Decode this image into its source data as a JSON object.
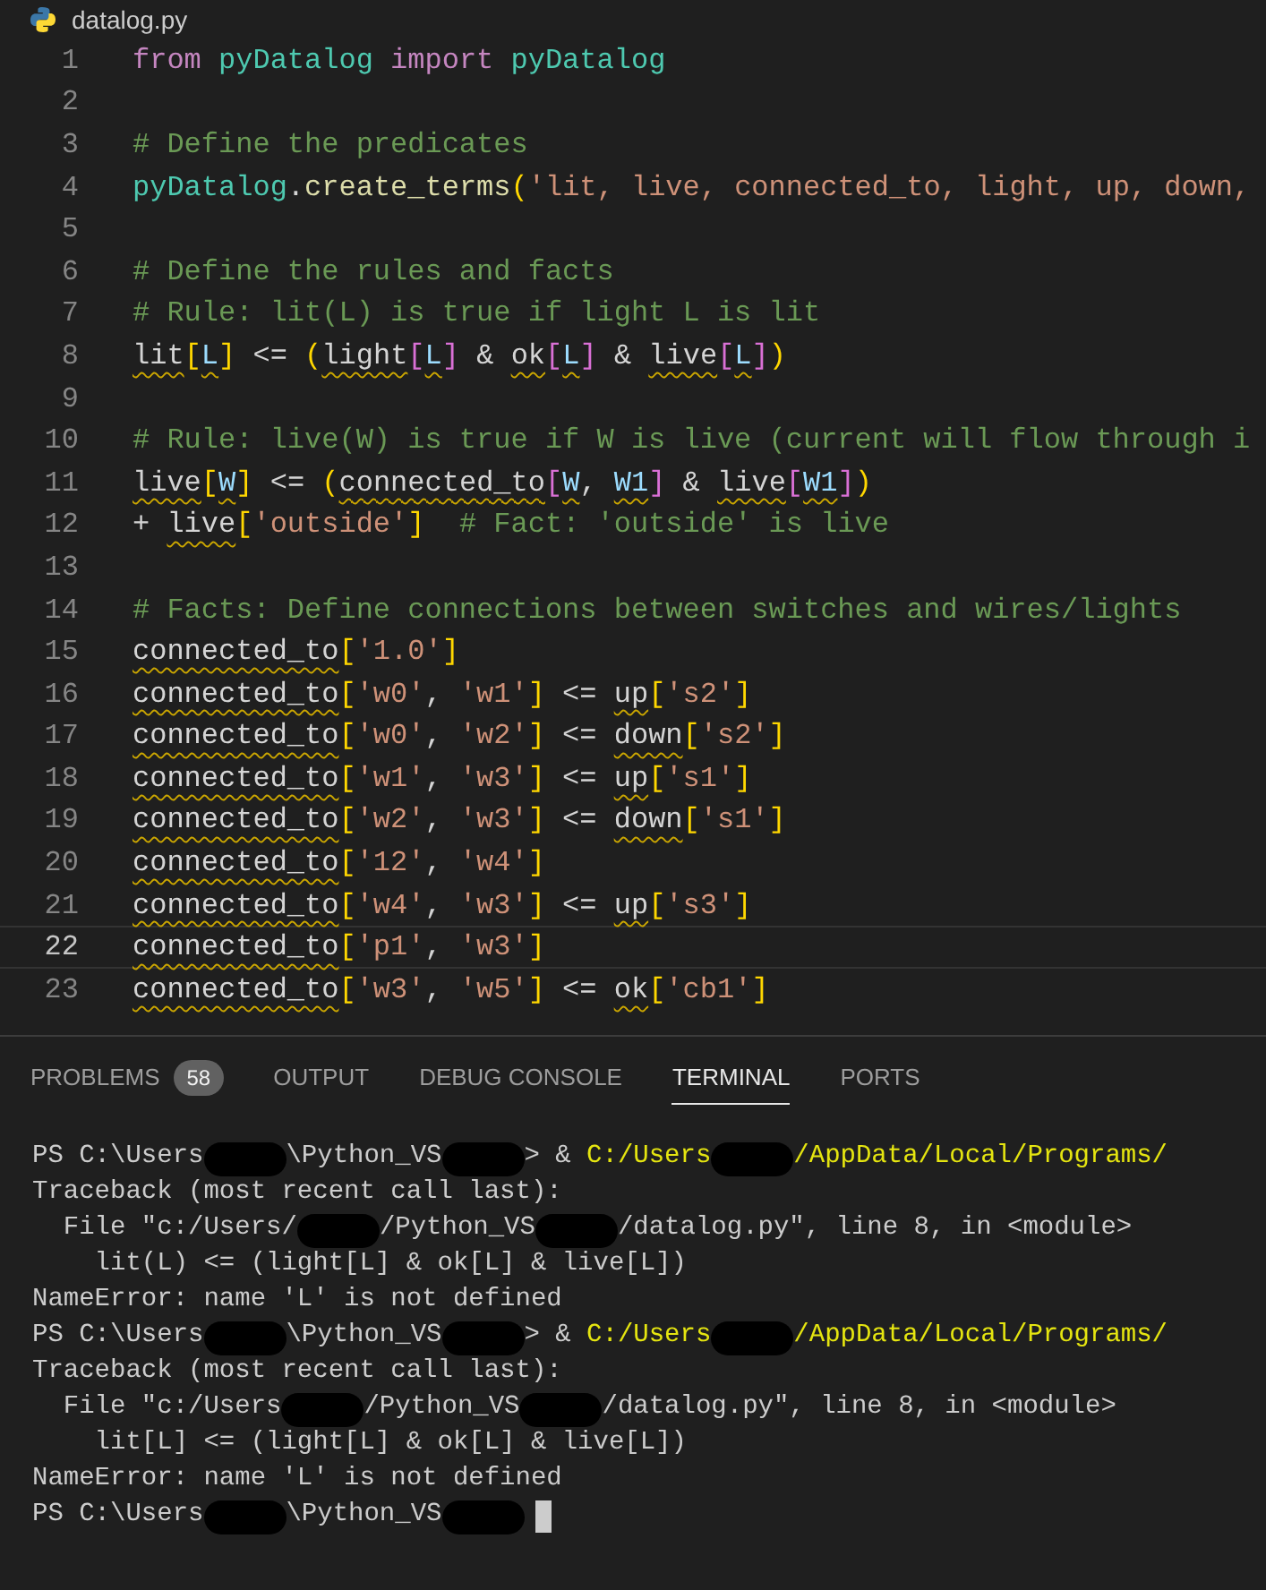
{
  "editor": {
    "filename": "datalog.py",
    "lines": [
      {
        "number": "1",
        "current": false,
        "tokens": [
          {
            "text": "from ",
            "kind": "kw",
            "warning": false
          },
          {
            "text": "pyDatalog ",
            "kind": "cls",
            "warning": false
          },
          {
            "text": "import ",
            "kind": "kw",
            "warning": false
          },
          {
            "text": "pyDatalog",
            "kind": "cls",
            "warning": false
          }
        ]
      },
      {
        "number": "2",
        "current": false
      },
      {
        "number": "3",
        "current": false,
        "tokens": [
          {
            "text": "# Define the predicates",
            "kind": "cmt",
            "warning": false
          }
        ]
      },
      {
        "number": "4",
        "current": false,
        "tokens": [
          {
            "text": "pyDatalog",
            "kind": "cls",
            "warning": false
          },
          {
            "text": ".",
            "kind": "op",
            "warning": false
          },
          {
            "text": "create_terms",
            "kind": "fn",
            "warning": false
          },
          {
            "text": "(",
            "kind": "b1",
            "warning": false
          },
          {
            "text": "'lit, live, connected_to, light, up, down,",
            "kind": "str",
            "warning": false
          }
        ]
      },
      {
        "number": "5",
        "current": false
      },
      {
        "number": "6",
        "current": false,
        "tokens": [
          {
            "text": "# Define the rules and facts",
            "kind": "cmt",
            "warning": false
          }
        ]
      },
      {
        "number": "7",
        "current": false,
        "tokens": [
          {
            "text": "# Rule: lit(L) is true if light L is lit",
            "kind": "cmt",
            "warning": false
          }
        ]
      },
      {
        "number": "8",
        "current": false,
        "tokens": [
          {
            "text": "lit",
            "kind": "id",
            "warning": true
          },
          {
            "text": "[",
            "kind": "b1",
            "warning": false
          },
          {
            "text": "L",
            "kind": "var",
            "warning": true
          },
          {
            "text": "]",
            "kind": "b1",
            "warning": false
          },
          {
            "text": " <= ",
            "kind": "op",
            "warning": false
          },
          {
            "text": "(",
            "kind": "b1",
            "warning": false
          },
          {
            "text": "light",
            "kind": "id",
            "warning": true
          },
          {
            "text": "[",
            "kind": "b2",
            "warning": false
          },
          {
            "text": "L",
            "kind": "var",
            "warning": true
          },
          {
            "text": "]",
            "kind": "b2",
            "warning": false
          },
          {
            "text": " & ",
            "kind": "op",
            "warning": false
          },
          {
            "text": "ok",
            "kind": "id",
            "warning": true
          },
          {
            "text": "[",
            "kind": "b2",
            "warning": false
          },
          {
            "text": "L",
            "kind": "var",
            "warning": true
          },
          {
            "text": "]",
            "kind": "b2",
            "warning": false
          },
          {
            "text": " & ",
            "kind": "op",
            "warning": false
          },
          {
            "text": "live",
            "kind": "id",
            "warning": true
          },
          {
            "text": "[",
            "kind": "b2",
            "warning": false
          },
          {
            "text": "L",
            "kind": "var",
            "warning": true
          },
          {
            "text": "]",
            "kind": "b2",
            "warning": false
          },
          {
            "text": ")",
            "kind": "b1",
            "warning": false
          }
        ]
      },
      {
        "number": "9",
        "current": false
      },
      {
        "number": "10",
        "current": false,
        "tokens": [
          {
            "text": "# Rule: live(W) is true if W is live (current will flow through i",
            "kind": "cmt",
            "warning": false
          }
        ]
      },
      {
        "number": "11",
        "current": false,
        "tokens": [
          {
            "text": "live",
            "kind": "id",
            "warning": true
          },
          {
            "text": "[",
            "kind": "b1",
            "warning": false
          },
          {
            "text": "W",
            "kind": "var",
            "warning": true
          },
          {
            "text": "]",
            "kind": "b1",
            "warning": false
          },
          {
            "text": " <= ",
            "kind": "op",
            "warning": false
          },
          {
            "text": "(",
            "kind": "b1",
            "warning": false
          },
          {
            "text": "connected_to",
            "kind": "id",
            "warning": true
          },
          {
            "text": "[",
            "kind": "b2",
            "warning": false
          },
          {
            "text": "W",
            "kind": "var",
            "warning": true
          },
          {
            "text": ", ",
            "kind": "op",
            "warning": false
          },
          {
            "text": "W1",
            "kind": "var",
            "warning": true
          },
          {
            "text": "]",
            "kind": "b2",
            "warning": false
          },
          {
            "text": " & ",
            "kind": "op",
            "warning": false
          },
          {
            "text": "live",
            "kind": "id",
            "warning": true
          },
          {
            "text": "[",
            "kind": "b2",
            "warning": false
          },
          {
            "text": "W1",
            "kind": "var",
            "warning": true
          },
          {
            "text": "]",
            "kind": "b2",
            "warning": false
          },
          {
            "text": ")",
            "kind": "b1",
            "warning": false
          }
        ]
      },
      {
        "number": "12",
        "current": false,
        "tokens": [
          {
            "text": "+ ",
            "kind": "op",
            "warning": false
          },
          {
            "text": "live",
            "kind": "id",
            "warning": true
          },
          {
            "text": "[",
            "kind": "b1",
            "warning": false
          },
          {
            "text": "'outside'",
            "kind": "str",
            "warning": false
          },
          {
            "text": "]",
            "kind": "b1",
            "warning": false
          },
          {
            "text": "  # Fact: 'outside' is live",
            "kind": "cmt",
            "warning": false
          }
        ]
      },
      {
        "number": "13",
        "current": false
      },
      {
        "number": "14",
        "current": false,
        "tokens": [
          {
            "text": "# Facts: Define connections between switches and wires/lights",
            "kind": "cmt",
            "warning": false
          }
        ]
      },
      {
        "number": "15",
        "current": false,
        "tokens": [
          {
            "text": "connected_to",
            "kind": "id",
            "warning": true
          },
          {
            "text": "[",
            "kind": "b1",
            "warning": false
          },
          {
            "text": "'1.0'",
            "kind": "str",
            "warning": false
          },
          {
            "text": "]",
            "kind": "b1",
            "warning": false
          }
        ]
      },
      {
        "number": "16",
        "current": false,
        "tokens": [
          {
            "text": "connected_to",
            "kind": "id",
            "warning": true
          },
          {
            "text": "[",
            "kind": "b1",
            "warning": false
          },
          {
            "text": "'w0'",
            "kind": "str",
            "warning": false
          },
          {
            "text": ", ",
            "kind": "op",
            "warning": false
          },
          {
            "text": "'w1'",
            "kind": "str",
            "warning": false
          },
          {
            "text": "]",
            "kind": "b1",
            "warning": false
          },
          {
            "text": " <= ",
            "kind": "op",
            "warning": false
          },
          {
            "text": "up",
            "kind": "id",
            "warning": true
          },
          {
            "text": "[",
            "kind": "b1",
            "warning": false
          },
          {
            "text": "'s2'",
            "kind": "str",
            "warning": false
          },
          {
            "text": "]",
            "kind": "b1",
            "warning": false
          }
        ]
      },
      {
        "number": "17",
        "current": false,
        "tokens": [
          {
            "text": "connected_to",
            "kind": "id",
            "warning": true
          },
          {
            "text": "[",
            "kind": "b1",
            "warning": false
          },
          {
            "text": "'w0'",
            "kind": "str",
            "warning": false
          },
          {
            "text": ", ",
            "kind": "op",
            "warning": false
          },
          {
            "text": "'w2'",
            "kind": "str",
            "warning": false
          },
          {
            "text": "]",
            "kind": "b1",
            "warning": false
          },
          {
            "text": " <= ",
            "kind": "op",
            "warning": false
          },
          {
            "text": "down",
            "kind": "id",
            "warning": true
          },
          {
            "text": "[",
            "kind": "b1",
            "warning": false
          },
          {
            "text": "'s2'",
            "kind": "str",
            "warning": false
          },
          {
            "text": "]",
            "kind": "b1",
            "warning": false
          }
        ]
      },
      {
        "number": "18",
        "current": false,
        "tokens": [
          {
            "text": "connected_to",
            "kind": "id",
            "warning": true
          },
          {
            "text": "[",
            "kind": "b1",
            "warning": false
          },
          {
            "text": "'w1'",
            "kind": "str",
            "warning": false
          },
          {
            "text": ", ",
            "kind": "op",
            "warning": false
          },
          {
            "text": "'w3'",
            "kind": "str",
            "warning": false
          },
          {
            "text": "]",
            "kind": "b1",
            "warning": false
          },
          {
            "text": " <= ",
            "kind": "op",
            "warning": false
          },
          {
            "text": "up",
            "kind": "id",
            "warning": true
          },
          {
            "text": "[",
            "kind": "b1",
            "warning": false
          },
          {
            "text": "'s1'",
            "kind": "str",
            "warning": false
          },
          {
            "text": "]",
            "kind": "b1",
            "warning": false
          }
        ]
      },
      {
        "number": "19",
        "current": false,
        "tokens": [
          {
            "text": "connected_to",
            "kind": "id",
            "warning": true
          },
          {
            "text": "[",
            "kind": "b1",
            "warning": false
          },
          {
            "text": "'w2'",
            "kind": "str",
            "warning": false
          },
          {
            "text": ", ",
            "kind": "op",
            "warning": false
          },
          {
            "text": "'w3'",
            "kind": "str",
            "warning": false
          },
          {
            "text": "]",
            "kind": "b1",
            "warning": false
          },
          {
            "text": " <= ",
            "kind": "op",
            "warning": false
          },
          {
            "text": "down",
            "kind": "id",
            "warning": true
          },
          {
            "text": "[",
            "kind": "b1",
            "warning": false
          },
          {
            "text": "'s1'",
            "kind": "str",
            "warning": false
          },
          {
            "text": "]",
            "kind": "b1",
            "warning": false
          }
        ]
      },
      {
        "number": "20",
        "current": false,
        "tokens": [
          {
            "text": "connected_to",
            "kind": "id",
            "warning": true
          },
          {
            "text": "[",
            "kind": "b1",
            "warning": false
          },
          {
            "text": "'12'",
            "kind": "str",
            "warning": false
          },
          {
            "text": ", ",
            "kind": "op",
            "warning": false
          },
          {
            "text": "'w4'",
            "kind": "str",
            "warning": false
          },
          {
            "text": "]",
            "kind": "b1",
            "warning": false
          }
        ]
      },
      {
        "number": "21",
        "current": false,
        "tokens": [
          {
            "text": "connected_to",
            "kind": "id",
            "warning": true
          },
          {
            "text": "[",
            "kind": "b1",
            "warning": false
          },
          {
            "text": "'w4'",
            "kind": "str",
            "warning": false
          },
          {
            "text": ", ",
            "kind": "op",
            "warning": false
          },
          {
            "text": "'w3'",
            "kind": "str",
            "warning": false
          },
          {
            "text": "]",
            "kind": "b1",
            "warning": false
          },
          {
            "text": " <= ",
            "kind": "op",
            "warning": false
          },
          {
            "text": "up",
            "kind": "id",
            "warning": true
          },
          {
            "text": "[",
            "kind": "b1",
            "warning": false
          },
          {
            "text": "'s3'",
            "kind": "str",
            "warning": false
          },
          {
            "text": "]",
            "kind": "b1",
            "warning": false
          }
        ]
      },
      {
        "number": "22",
        "current": true,
        "tokens": [
          {
            "text": "connected_to",
            "kind": "id",
            "warning": true
          },
          {
            "text": "[",
            "kind": "b1",
            "warning": false
          },
          {
            "text": "'p1'",
            "kind": "str",
            "warning": false
          },
          {
            "text": ", ",
            "kind": "op",
            "warning": false
          },
          {
            "text": "'w3'",
            "kind": "str",
            "warning": false
          },
          {
            "text": "]",
            "kind": "b1",
            "warning": false
          }
        ]
      },
      {
        "number": "23",
        "current": false,
        "tokens": [
          {
            "text": "connected_to",
            "kind": "id",
            "warning": true
          },
          {
            "text": "[",
            "kind": "b1",
            "warning": false
          },
          {
            "text": "'w3'",
            "kind": "str",
            "warning": false
          },
          {
            "text": ", ",
            "kind": "op",
            "warning": false
          },
          {
            "text": "'w5'",
            "kind": "str",
            "warning": false
          },
          {
            "text": "]",
            "kind": "b1",
            "warning": false
          },
          {
            "text": " <= ",
            "kind": "op",
            "warning": false
          },
          {
            "text": "ok",
            "kind": "id",
            "warning": true
          },
          {
            "text": "[",
            "kind": "b1",
            "warning": false
          },
          {
            "text": "'cb1'",
            "kind": "str",
            "warning": false
          },
          {
            "text": "]",
            "kind": "b1",
            "warning": false
          }
        ]
      }
    ]
  },
  "panel": {
    "tabs": [
      {
        "label": "PROBLEMS",
        "badge": "58",
        "selected": false
      },
      {
        "label": "OUTPUT",
        "selected": false
      },
      {
        "label": "DEBUG CONSOLE",
        "selected": false
      },
      {
        "label": "TERMINAL",
        "selected": true
      },
      {
        "label": "PORTS",
        "selected": false
      }
    ],
    "terminal": [
      [
        {
          "kind": "text",
          "text": "PS C:\\Users"
        },
        {
          "kind": "redacted"
        },
        {
          "kind": "text",
          "text": "\\Python_VS"
        },
        {
          "kind": "redacted"
        },
        {
          "kind": "text",
          "text": "> & "
        },
        {
          "kind": "path",
          "text": "C:/Users"
        },
        {
          "kind": "redacted"
        },
        {
          "kind": "path",
          "text": "/AppData/Local/Programs/"
        }
      ],
      [
        {
          "kind": "text",
          "text": "Traceback (most recent call last):"
        }
      ],
      [
        {
          "kind": "text",
          "text": "  File \"c:/Users/"
        },
        {
          "kind": "redacted"
        },
        {
          "kind": "text",
          "text": "/Python_VS"
        },
        {
          "kind": "redacted"
        },
        {
          "kind": "text",
          "text": "/datalog.py\", line 8, in <module>"
        }
      ],
      [
        {
          "kind": "text",
          "text": "    lit(L) <= (light[L] & ok[L] & live[L])"
        }
      ],
      [
        {
          "kind": "text",
          "text": "NameError: name 'L' is not defined"
        }
      ],
      [
        {
          "kind": "text",
          "text": "PS C:\\Users"
        },
        {
          "kind": "redacted"
        },
        {
          "kind": "text",
          "text": "\\Python_VS"
        },
        {
          "kind": "redacted"
        },
        {
          "kind": "text",
          "text": "> & "
        },
        {
          "kind": "path",
          "text": "C:/Users"
        },
        {
          "kind": "redacted"
        },
        {
          "kind": "path",
          "text": "/AppData/Local/Programs/"
        }
      ],
      [
        {
          "kind": "text",
          "text": "Traceback (most recent call last):"
        }
      ],
      [
        {
          "kind": "text",
          "text": "  File \"c:/Users"
        },
        {
          "kind": "redacted"
        },
        {
          "kind": "text",
          "text": "/Python_VS"
        },
        {
          "kind": "redacted"
        },
        {
          "kind": "text",
          "text": "/datalog.py\", line 8, in <module>"
        }
      ],
      [
        {
          "kind": "text",
          "text": "    lit[L] <= (light[L] & ok[L] & live[L])"
        }
      ],
      [
        {
          "kind": "text",
          "text": "NameError: name 'L' is not defined"
        }
      ],
      [
        {
          "kind": "text",
          "text": "PS C:\\Users"
        },
        {
          "kind": "redacted"
        },
        {
          "kind": "text",
          "text": "\\Python_VS"
        },
        {
          "kind": "redacted"
        },
        {
          "kind": "cursor"
        }
      ]
    ]
  }
}
